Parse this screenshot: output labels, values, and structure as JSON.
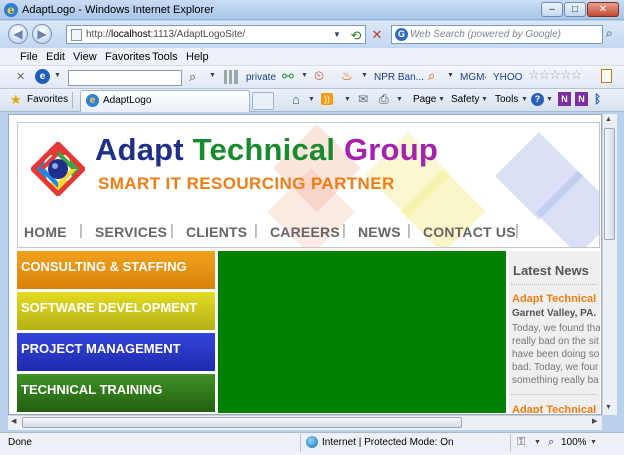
{
  "window": {
    "title": "AdaptLogo - Windows Internet Explorer"
  },
  "address_bar": {
    "url_prefix": "http://",
    "url_host": "localhost",
    "url_rest": ":1113/AdaptLogoSite/"
  },
  "search": {
    "placeholder": "Web Search (powered by Google)"
  },
  "menu": [
    "File",
    "Edit",
    "View",
    "Favorites",
    "Tools",
    "Help"
  ],
  "toolbar": {
    "private_label": "private",
    "npr_label": "NPR Ban...",
    "mgm_label": "MGM",
    "yhoo_label": "YHOO",
    "separator": "·"
  },
  "favorites_bar": {
    "favorites_label": "Favorites",
    "tab_title": "AdaptLogo",
    "page_label": "Page",
    "safety_label": "Safety",
    "tools_label": "Tools"
  },
  "site": {
    "brand_word1": "Adapt",
    "brand_word2": "Technical",
    "brand_word3": "Group",
    "tagline": "SMART IT RESOURCING PARTNER",
    "nav": [
      "HOME",
      "SERVICES",
      "CLIENTS",
      "CAREERS",
      "NEWS",
      "CONTACT US"
    ],
    "nav_separator": "|",
    "services": [
      "CONSULTING & STAFFING",
      "SOFTWARE DEVELOPMENT",
      "PROJECT MANAGEMENT",
      "TECHNICAL TRAINING"
    ],
    "news": {
      "heading": "Latest News",
      "item1_title": "Adapt Technical",
      "item1_location": "Garnet Valley, PA.",
      "item1_lines": [
        "Today, we found tha",
        "really bad on the sit",
        "have been doing so",
        "bad. Today, we four",
        "something really ba"
      ],
      "item2_title": "Adapt Technical"
    }
  },
  "status": {
    "left": "Done",
    "zone": "Internet | Protected Mode: On",
    "zoom": "100%"
  },
  "colors": {
    "brand_blue": "#1f2f8a",
    "brand_green": "#1a8a2e",
    "brand_purple": "#a521b0",
    "tagline_orange": "#ef7d15",
    "nav_orange": "#e6920e",
    "nav_yellow": "#c8c418",
    "nav_blue": "#2737c6",
    "nav_green": "#2f7d1e",
    "content_green": "#008000"
  },
  "icons": [
    "ie-logo-icon",
    "back-arrow-icon",
    "forward-arrow-icon",
    "page-icon",
    "refresh-icon",
    "stop-icon",
    "search-icon",
    "star-icon",
    "home-icon",
    "rss-icon",
    "print-icon",
    "help-icon",
    "globe-icon"
  ]
}
